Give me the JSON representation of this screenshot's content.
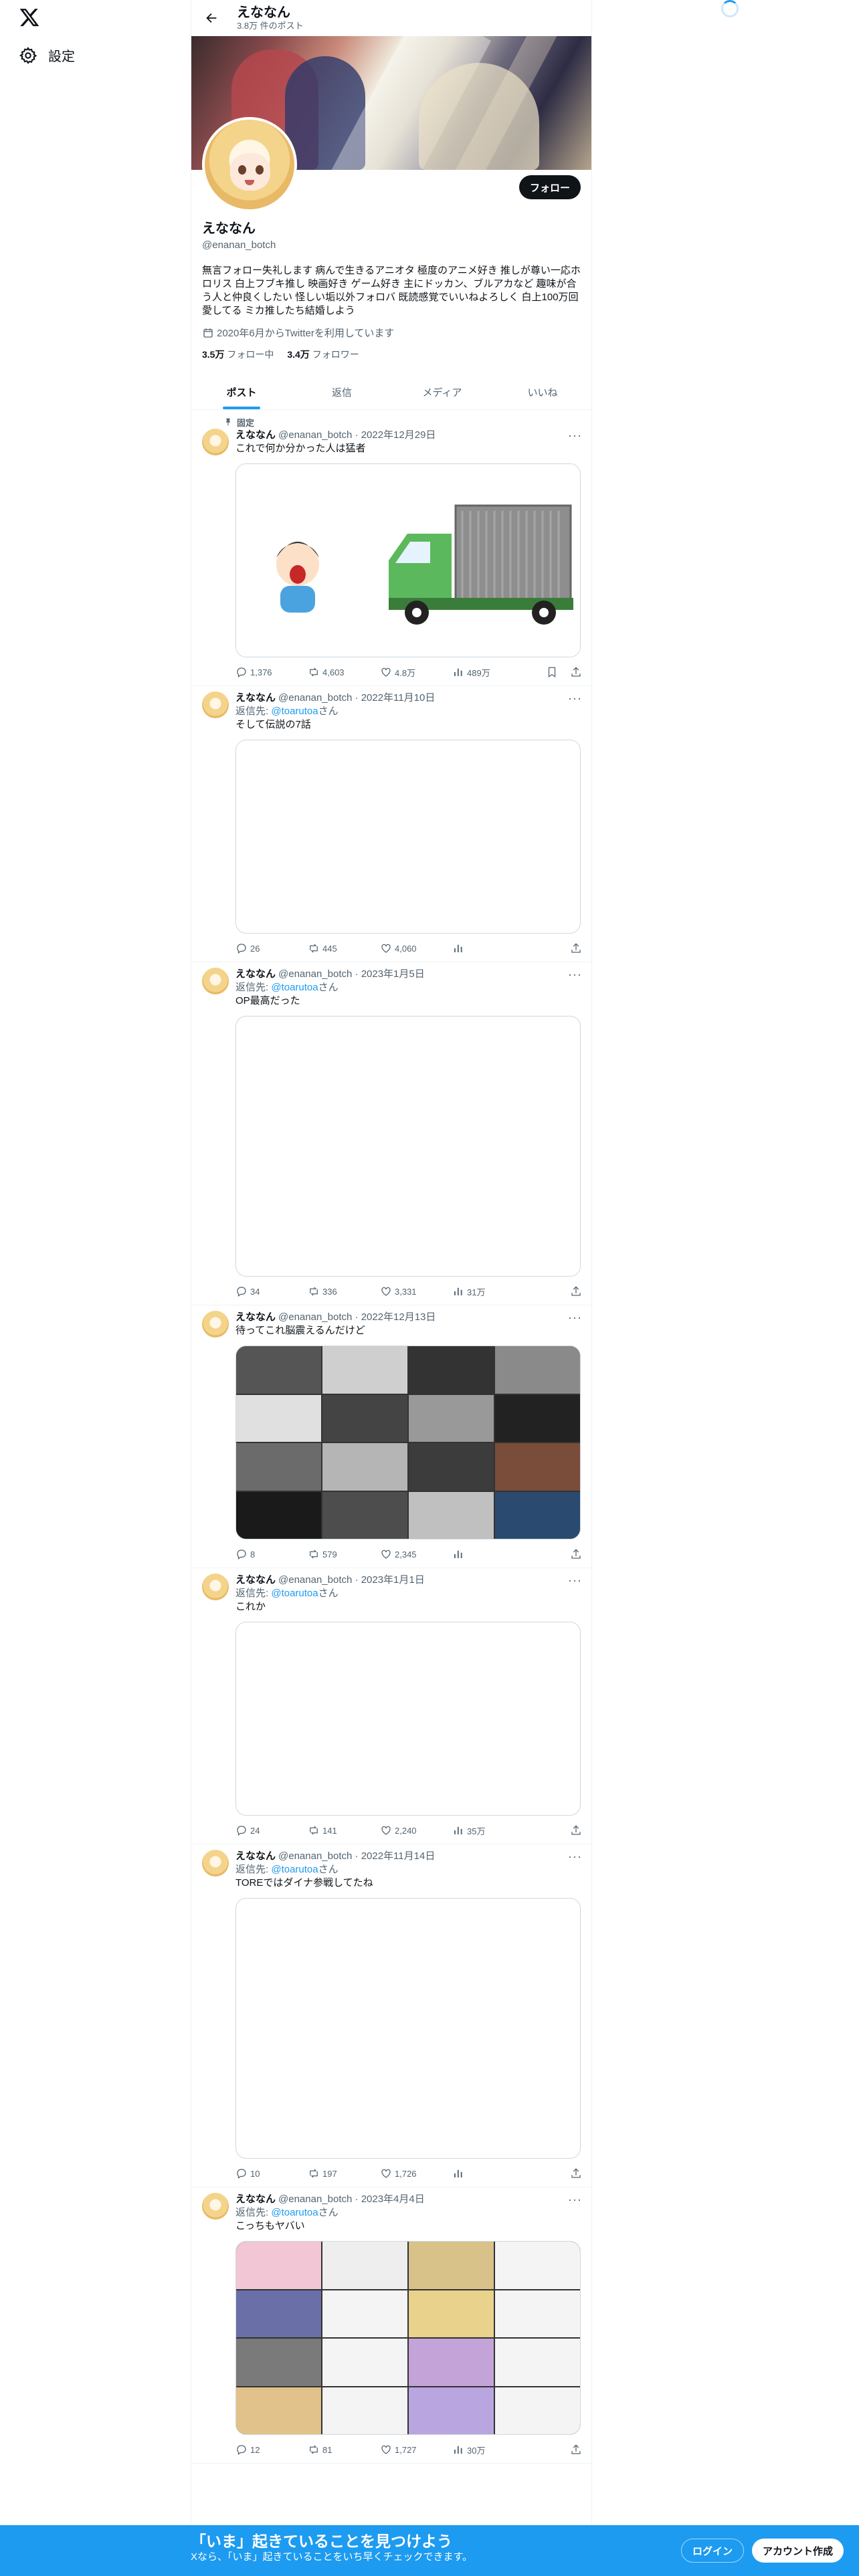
{
  "nav": {
    "settings_label": "設定"
  },
  "header": {
    "name": "えななん",
    "post_count": "3.8万 件のポスト"
  },
  "profile": {
    "display_name": "えななん",
    "handle": "@enanan_botch",
    "follow_label": "フォロー",
    "bio": "無言フォロー失礼します 病んで生きるアニオタ 極度のアニメ好き 推しが尊い一応ホロリス 白上フブキ推し 映画好き ゲーム好き 主にドッカン、ブルアカなど 趣味が合う人と仲良くしたい 怪しい垢以外フォロバ 既読感覚でいいねよろしく 白上100万回愛してる ミカ推したち結婚しよう",
    "joined": "2020年6月からTwitterを利用しています",
    "following_count": "3.5万",
    "following_label": "フォロー中",
    "followers_count": "3.4万",
    "followers_label": "フォロワー"
  },
  "tabs": [
    "ポスト",
    "返信",
    "メディア",
    "いいね"
  ],
  "pinned_label": "固定",
  "reply_prefix": "返信先: ",
  "reply_suffix": "さん",
  "tweets": [
    {
      "name": "えななん",
      "handle": "@enanan_botch",
      "date": "2022年12月29日",
      "reply_to": "",
      "text": "これで何か分かった人は猛者",
      "replies": "1,376",
      "retweets": "4,603",
      "likes": "4.8万",
      "views": "489万",
      "pinned": true
    },
    {
      "name": "えななん",
      "handle": "@enanan_botch",
      "date": "2022年11月10日",
      "reply_to": "@toarutoa",
      "text": "そして伝説の7話",
      "replies": "26",
      "retweets": "445",
      "likes": "4,060",
      "views": ""
    },
    {
      "name": "えななん",
      "handle": "@enanan_botch",
      "date": "2023年1月5日",
      "reply_to": "@toarutoa",
      "text": "OP最高だった",
      "replies": "34",
      "retweets": "336",
      "likes": "3,331",
      "views": "31万"
    },
    {
      "name": "えななん",
      "handle": "@enanan_botch",
      "date": "2022年12月13日",
      "reply_to": "",
      "text": "待ってこれ脳震えるんだけど",
      "replies": "8",
      "retweets": "579",
      "likes": "2,345",
      "views": ""
    },
    {
      "name": "えななん",
      "handle": "@enanan_botch",
      "date": "2023年1月1日",
      "reply_to": "@toarutoa",
      "text": "これか",
      "replies": "24",
      "retweets": "141",
      "likes": "2,240",
      "views": "35万"
    },
    {
      "name": "えななん",
      "handle": "@enanan_botch",
      "date": "2022年11月14日",
      "reply_to": "@toarutoa",
      "text": "TOREではダイナ参戦してたね",
      "replies": "10",
      "retweets": "197",
      "likes": "1,726",
      "views": ""
    },
    {
      "name": "えななん",
      "handle": "@enanan_botch",
      "date": "2023年4月4日",
      "reply_to": "@toarutoa",
      "text": "こっちもヤバい",
      "replies": "12",
      "retweets": "81",
      "likes": "1,727",
      "views": "30万"
    }
  ],
  "bottom": {
    "headline": "「いま」起きていることを見つけよう",
    "sub": "Xなら、「いま」起きていることをいち早くチェックできます。",
    "login_label": "ログイン",
    "signup_label": "アカウント作成"
  },
  "colors": {
    "accent": "#1d9bf0",
    "text": "#0f1419",
    "muted": "#536471"
  }
}
